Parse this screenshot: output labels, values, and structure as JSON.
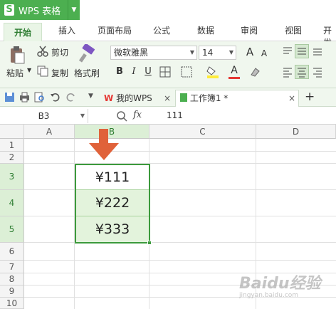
{
  "app": {
    "title": "WPS 表格",
    "logo_letter": "S"
  },
  "ribbon_tabs": [
    "开始",
    "插入",
    "页面布局",
    "公式",
    "数据",
    "审阅",
    "视图",
    "开发"
  ],
  "ribbon": {
    "cut_label": "剪切",
    "copy_label": "复制",
    "paste_label": "粘贴",
    "format_painter_label": "格式刷",
    "font_name": "微软雅黑",
    "font_size": "14",
    "bold": "B",
    "italic": "I",
    "underline": "U",
    "grow_font": "A",
    "shrink_font": "A"
  },
  "doc_tabs": {
    "mywps": "我的WPS",
    "workbook": "工作簿1 *",
    "new_tab": "+"
  },
  "formula_bar": {
    "name_box": "B3",
    "fx": "fx",
    "content": "111"
  },
  "grid": {
    "columns": [
      "A",
      "B",
      "C",
      "D"
    ],
    "rows": [
      "1",
      "2",
      "3",
      "4",
      "5",
      "6",
      "7",
      "8",
      "9",
      "10"
    ],
    "values": {
      "B3": "¥111",
      "B4": "¥222",
      "B5": "¥333"
    }
  },
  "watermark": {
    "text": "Baidu经验",
    "sub": "jingyan.baidu.com"
  },
  "colors": {
    "accent": "#4caf50",
    "arrow": "#e0623a",
    "selection_fill": "#e3f3dc",
    "selection_border": "#3c9a3c"
  }
}
